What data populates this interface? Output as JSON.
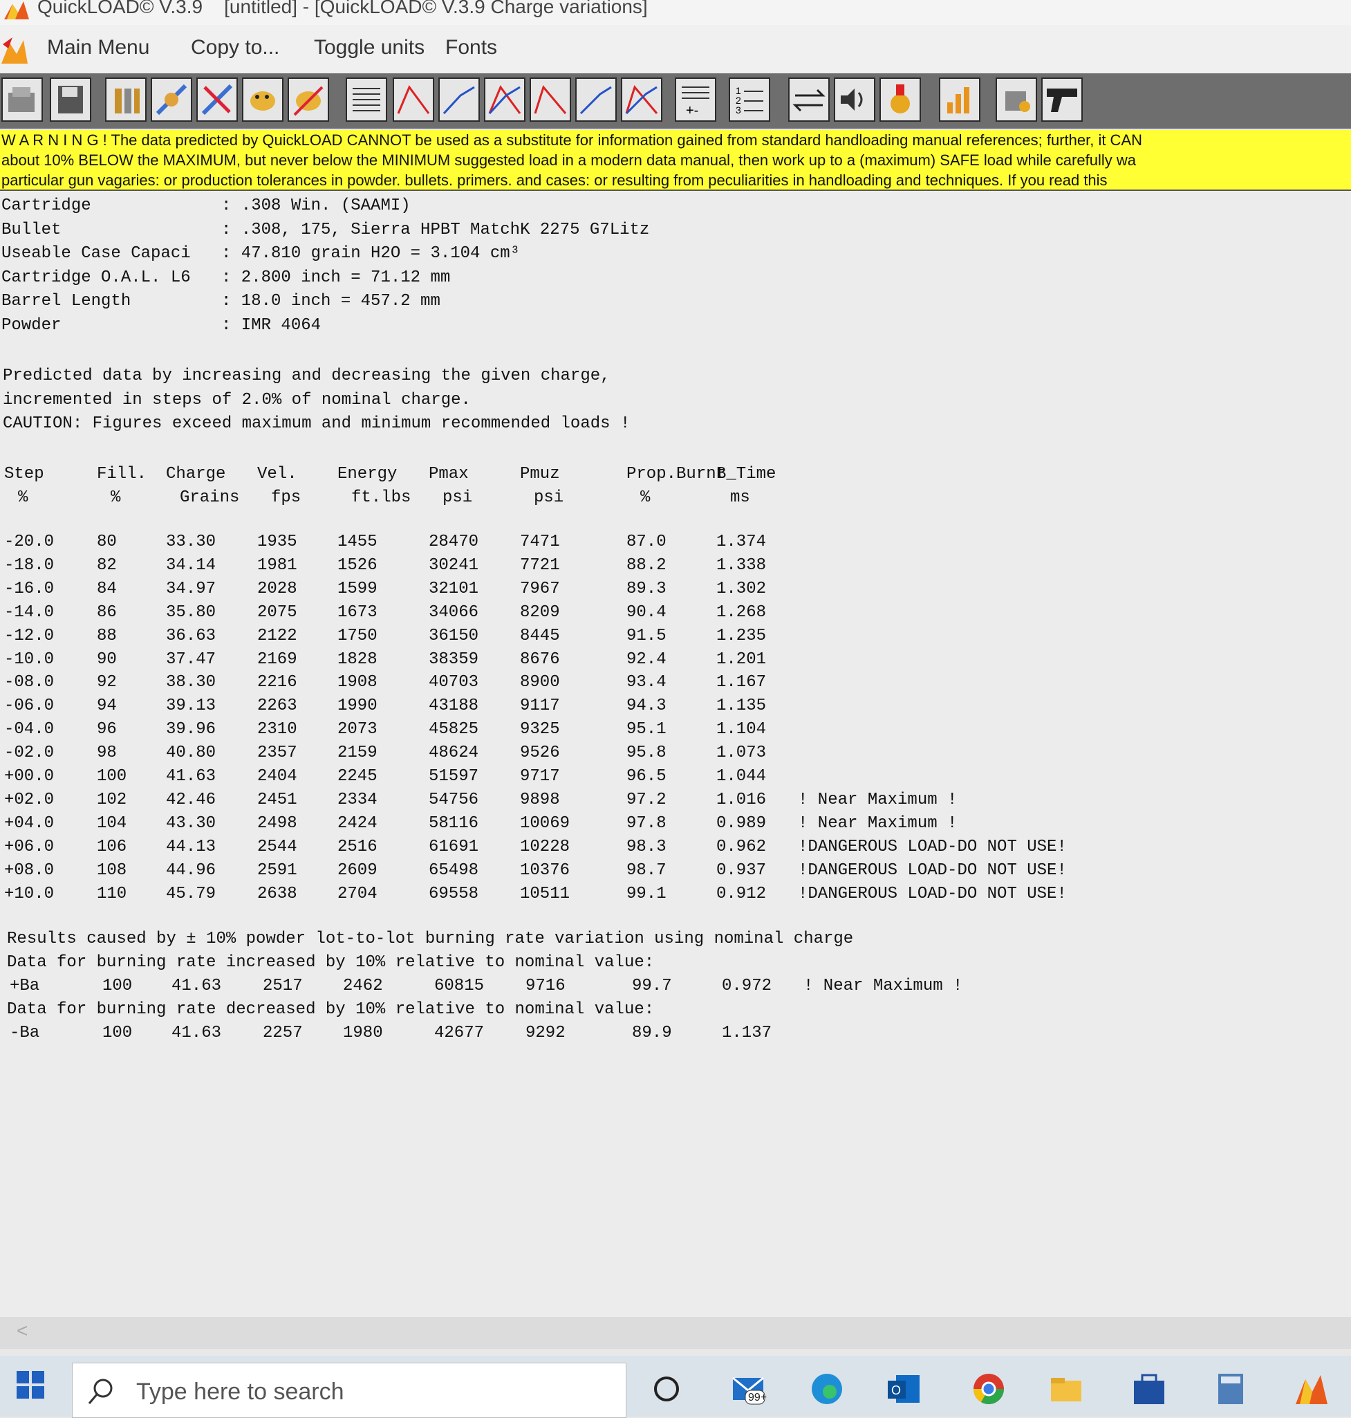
{
  "window": {
    "title": "QuickLOAD© V.3.9    [untitled] - [QuickLOAD© V.3.9 Charge variations]"
  },
  "menu": {
    "items": [
      "Main Menu",
      "Copy to...",
      "Toggle units",
      "Fonts"
    ]
  },
  "toolbar": {
    "icons": [
      "open-file-icon",
      "save-icon",
      "cartridge-icon",
      "bullet-edit-icon",
      "bullet-delete-icon",
      "powder-icon",
      "powder-edit-icon",
      "data-table-icon",
      "pressure-curve-icon",
      "velocity-curve-icon",
      "combined-curve-icon",
      "pressure-curve-2-icon",
      "velocity-curve-2-icon",
      "combined-curve-2-icon",
      "table-plus-icon",
      "numbered-list-icon",
      "convert-icon",
      "sound-icon",
      "medal-icon",
      "bar-chart-icon",
      "loader-icon",
      "pistol-icon"
    ]
  },
  "warning": {
    "lines": [
      "W A R N I N G ! The data predicted by QuickLOAD CANNOT be used as a substitute for information gained from standard handloading manual references; further, it CAN",
      "about 10% BELOW the MAXIMUM, but never below the MINIMUM suggested load in a modern data manual, then work up to a (maximum) SAFE load while carefully wa",
      "particular gun vagaries: or production tolerances in powder. bullets. primers. and cases: or resulting from peculiarities in handloading and techniques. If you read this"
    ]
  },
  "info": {
    "rows": [
      {
        "label": "Cartridge          ",
        "value": ": .308 Win. (SAAMI)"
      },
      {
        "label": "Bullet             ",
        "value": ": .308, 175, Sierra HPBT MatchK 2275 G7Litz"
      },
      {
        "label": "Useable Case Capaci",
        "value": ": 47.810 grain H2O = 3.104 cm³"
      },
      {
        "label": "Cartridge O.A.L. L6",
        "value": ": 2.800 inch = 71.12 mm"
      },
      {
        "label": "Barrel Length      ",
        "value": ": 18.0 inch = 457.2 mm"
      },
      {
        "label": "Powder             ",
        "value": ": IMR 4064"
      }
    ]
  },
  "notes": [
    "Predicted data by increasing and decreasing the given charge,",
    "incremented in steps of 2.0% of nominal charge.",
    "CAUTION: Figures exceed maximum and minimum recommended loads !"
  ],
  "table": {
    "headers": [
      "Step",
      "Fill.",
      "Charge",
      "Vel.",
      "Energy",
      "Pmax",
      "Pmuz",
      "Prop.Burnt",
      "B_Time"
    ],
    "units": [
      "%",
      "%",
      "Grains",
      "fps",
      "ft.lbs",
      "psi",
      "psi",
      "%",
      "ms"
    ],
    "rows": [
      [
        "-20.0",
        "80",
        "33.30",
        "1935",
        "1455",
        "28470",
        "7471",
        "87.0",
        "1.374",
        ""
      ],
      [
        "-18.0",
        "82",
        "34.14",
        "1981",
        "1526",
        "30241",
        "7721",
        "88.2",
        "1.338",
        ""
      ],
      [
        "-16.0",
        "84",
        "34.97",
        "2028",
        "1599",
        "32101",
        "7967",
        "89.3",
        "1.302",
        ""
      ],
      [
        "-14.0",
        "86",
        "35.80",
        "2075",
        "1673",
        "34066",
        "8209",
        "90.4",
        "1.268",
        ""
      ],
      [
        "-12.0",
        "88",
        "36.63",
        "2122",
        "1750",
        "36150",
        "8445",
        "91.5",
        "1.235",
        ""
      ],
      [
        "-10.0",
        "90",
        "37.47",
        "2169",
        "1828",
        "38359",
        "8676",
        "92.4",
        "1.201",
        ""
      ],
      [
        "-08.0",
        "92",
        "38.30",
        "2216",
        "1908",
        "40703",
        "8900",
        "93.4",
        "1.167",
        ""
      ],
      [
        "-06.0",
        "94",
        "39.13",
        "2263",
        "1990",
        "43188",
        "9117",
        "94.3",
        "1.135",
        ""
      ],
      [
        "-04.0",
        "96",
        "39.96",
        "2310",
        "2073",
        "45825",
        "9325",
        "95.1",
        "1.104",
        ""
      ],
      [
        "-02.0",
        "98",
        "40.80",
        "2357",
        "2159",
        "48624",
        "9526",
        "95.8",
        "1.073",
        ""
      ],
      [
        "+00.0",
        "100",
        "41.63",
        "2404",
        "2245",
        "51597",
        "9717",
        "96.5",
        "1.044",
        ""
      ],
      [
        "+02.0",
        "102",
        "42.46",
        "2451",
        "2334",
        "54756",
        "9898",
        "97.2",
        "1.016",
        "! Near Maximum !"
      ],
      [
        "+04.0",
        "104",
        "43.30",
        "2498",
        "2424",
        "58116",
        "10069",
        "97.8",
        "0.989",
        "! Near Maximum !"
      ],
      [
        "+06.0",
        "106",
        "44.13",
        "2544",
        "2516",
        "61691",
        "10228",
        "98.3",
        "0.962",
        "!DANGEROUS LOAD-DO NOT USE!"
      ],
      [
        "+08.0",
        "108",
        "44.96",
        "2591",
        "2609",
        "65498",
        "10376",
        "98.7",
        "0.937",
        "!DANGEROUS LOAD-DO NOT USE!"
      ],
      [
        "+10.0",
        "110",
        "45.79",
        "2638",
        "2704",
        "69558",
        "10511",
        "99.1",
        "0.912",
        "!DANGEROUS LOAD-DO NOT USE!"
      ]
    ]
  },
  "burn": {
    "title": "Results caused by ± 10% powder lot-to-lot burning rate variation using nominal charge",
    "inc_label": "Data for burning rate increased by 10% relative to nominal value:",
    "inc_row": [
      "+Ba",
      "100",
      "41.63",
      "2517",
      "2462",
      "60815",
      "9716",
      "99.7",
      "0.972",
      "! Near Maximum !"
    ],
    "dec_label": "Data for burning rate decreased by 10% relative to nominal value:",
    "dec_row": [
      "-Ba",
      "100",
      "41.63",
      "2257",
      "1980",
      "42677",
      "9292",
      "89.9",
      "1.137",
      ""
    ]
  },
  "taskbar": {
    "search_placeholder": "Type here to search",
    "mail_badge": "99+",
    "icons": [
      "task-view-icon",
      "mail-icon",
      "edge-icon",
      "outlook-icon",
      "chrome-icon",
      "file-explorer-icon",
      "store-icon",
      "calculator-icon",
      "quickload-taskbar-icon"
    ]
  },
  "colors": {
    "warning_bg": "#ffff33",
    "toolbar_bg": "#6e6e6e",
    "content_bg": "#ececec"
  }
}
